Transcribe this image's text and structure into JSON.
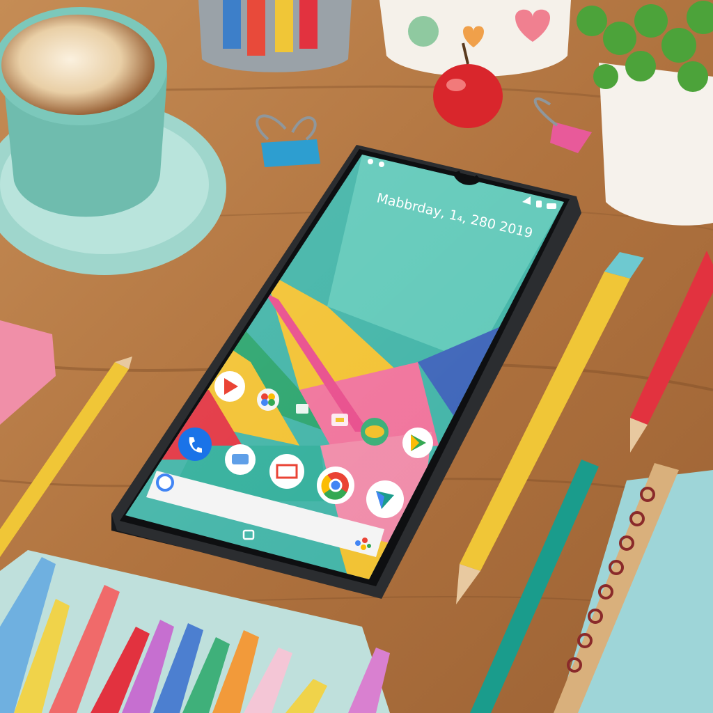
{
  "phone": {
    "date_text": "Mabbrday, 1₄, 280 2019",
    "status_icons": [
      "signal-icon",
      "lock-icon",
      "battery-icon"
    ]
  },
  "home_screen": {
    "icons": [
      "play-store-icon",
      "photos-icon",
      "phone-icon",
      "messages-icon",
      "gmail-icon",
      "chrome-icon",
      "play-movies-icon",
      "drive-icon",
      "play-games-icon",
      "files-icon"
    ],
    "search_bar": {
      "left_icon": "google-g-icon",
      "right_icon": "google-assistant-icon"
    }
  },
  "colors": {
    "wallpaper_teal": "#3fb3a6",
    "wallpaper_yellow": "#f2c12e",
    "wallpaper_pink": "#f0719a",
    "wallpaper_blue": "#3a62b8",
    "wallpaper_red": "#e2323f",
    "wood": "#b67a45",
    "phone_frame": "#2b2d30"
  }
}
